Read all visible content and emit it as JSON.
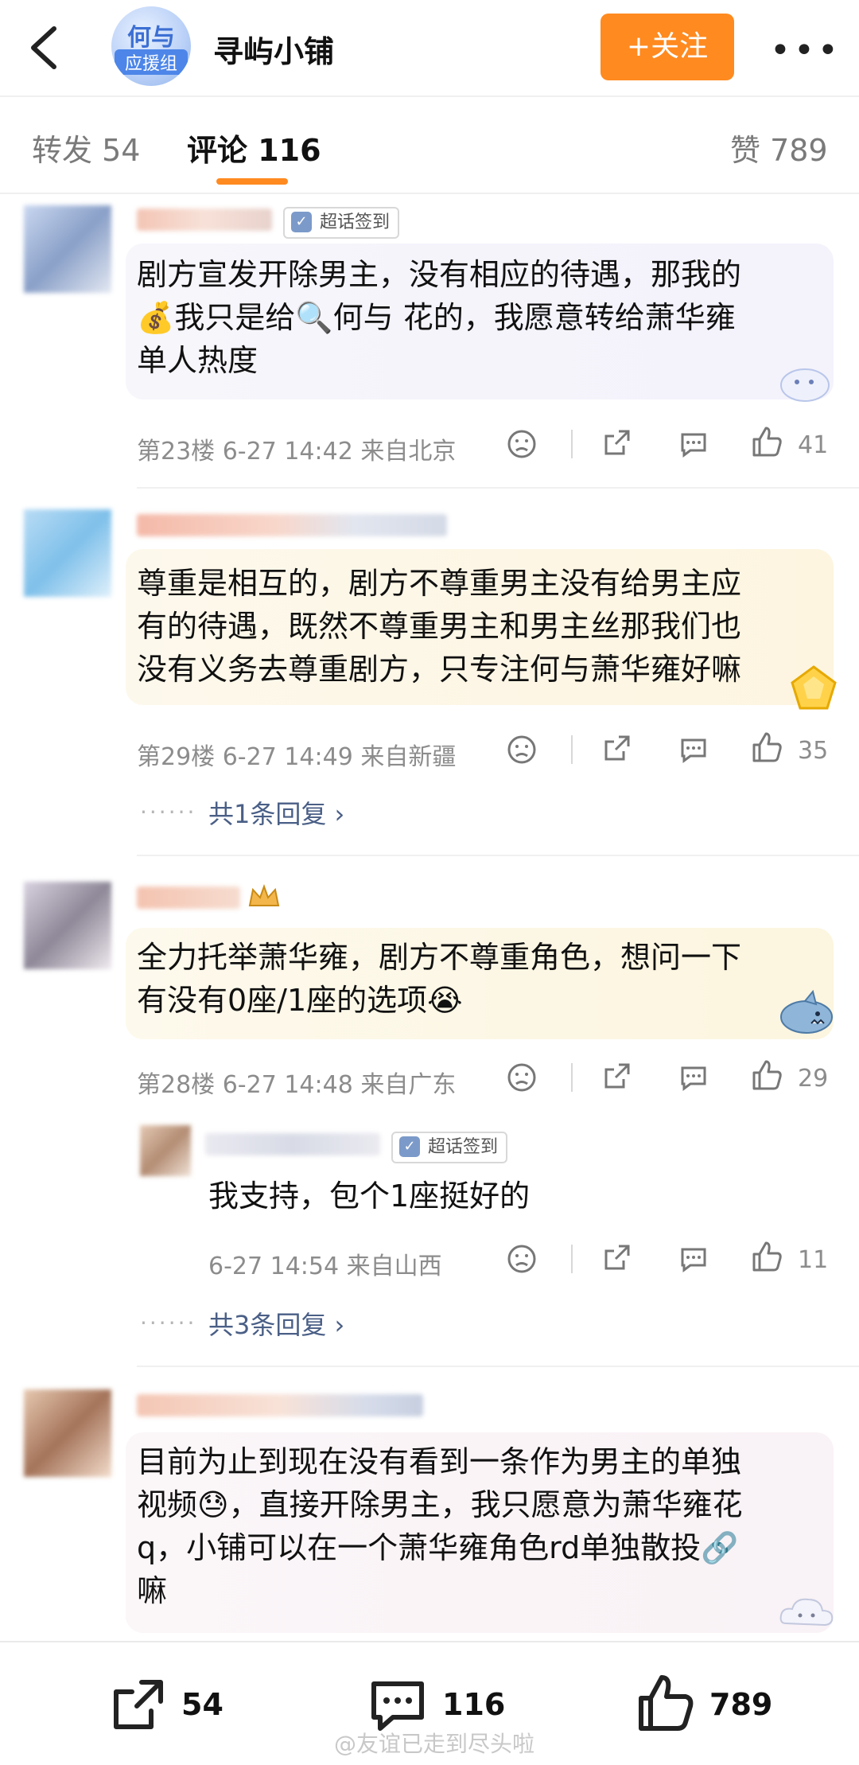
{
  "header": {
    "back_icon": "back-arrow-icon",
    "avatar_text_top": "何与",
    "avatar_text_bottom": "应援组",
    "shop_name": "寻屿小铺",
    "follow_label": "+关注",
    "more_icon": "more-dots-icon",
    "accent_color": "#ff8a1f"
  },
  "tabs": [
    {
      "label": "转发 54"
    },
    {
      "label": "评论 116"
    },
    {
      "label": "赞 789"
    }
  ],
  "comments": [
    {
      "badge": "超话签到",
      "lines": [
        "剧方宣发开除男主，没有相应的待遇，那我的",
        "💰我只是给🔍何与 花的，我愿意转给萧华雍",
        "单人热度"
      ],
      "meta": "第23楼 6-27 14:42 来自北京",
      "likes": "41"
    },
    {
      "lines": [
        "尊重是相互的，剧方不尊重男主没有给男主应",
        "有的待遇，既然不尊重男主和男主丝那我们也",
        "没有义务去尊重剧方，只专注何与萧华雍好嘛"
      ],
      "meta": "第29楼 6-27 14:49 来自新疆",
      "likes": "35",
      "replies": "共1条回复 ›"
    },
    {
      "lines": [
        "全力托举萧华雍，剧方不尊重角色，想问一下",
        "有没有0座/1座的选项😭"
      ],
      "meta": "第28楼 6-27 14:48 来自广东",
      "likes": "29",
      "reply": {
        "badge": "超话签到",
        "text": "我支持，包个1座挺好的",
        "meta": "6-27 14:54 来自山西",
        "likes": "11"
      },
      "replies": "共3条回复 ›"
    },
    {
      "lines": [
        "目前为止到现在没有看到一条作为男主的单独",
        "视频😓，直接开除男主，我只愿意为萧华雍花",
        "q，小铺可以在一个萧华雍角色rd单独散投🔗",
        "嘛"
      ]
    }
  ],
  "bottom_bar": {
    "share_count": "54",
    "comment_count": "116",
    "like_count": "789"
  },
  "watermark": "@友谊已走到尽头啦"
}
